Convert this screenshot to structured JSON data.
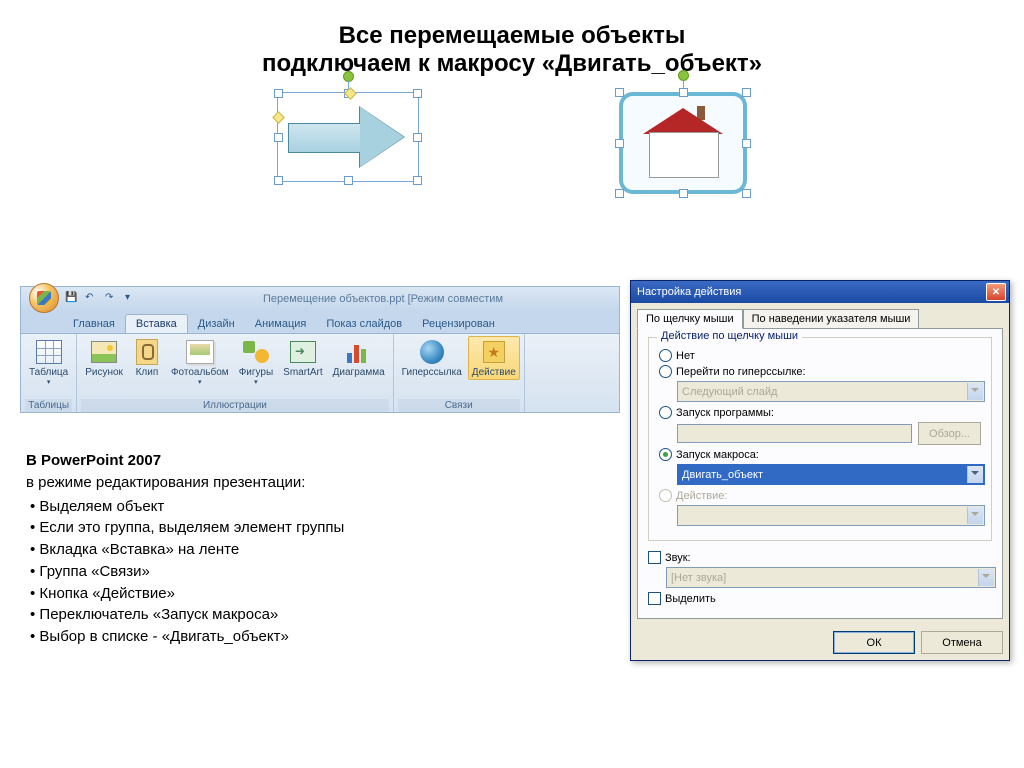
{
  "title_line1": "Все перемещаемые объекты",
  "title_line2": "подключаем к макросу «Двигать_объект»",
  "ribbon": {
    "window_title": "Перемещение объектов.ppt [Режим совместим",
    "tabs": {
      "home": "Главная",
      "insert": "Вставка",
      "design": "Дизайн",
      "anim": "Анимация",
      "show": "Показ слайдов",
      "review": "Рецензирован"
    },
    "buttons": {
      "table": "Таблица",
      "picture": "Рисунок",
      "clip": "Клип",
      "album": "Фотоальбом",
      "shapes": "Фигуры",
      "smartart": "SmartArt",
      "chart": "Диаграмма",
      "hyperlink": "Гиперссылка",
      "action": "Действие"
    },
    "groups": {
      "tables": "Таблицы",
      "illustrations": "Иллюстрации",
      "links": "Связи"
    }
  },
  "instructions": {
    "hdr": "В PowerPoint 2007",
    "intro": "в режиме редактирования презентации:",
    "items": [
      "Выделяем объект",
      "Если это группа, выделяем элемент группы",
      "Вкладка «Вставка» на ленте",
      "Группа «Связи»",
      "Кнопка «Действие»",
      "Переключатель «Запуск макроса»",
      "Выбор в списке - «Двигать_объект»"
    ]
  },
  "dialog": {
    "title": "Настройка действия",
    "tab_click": "По щелчку мыши",
    "tab_hover": "По наведении указателя мыши",
    "legend": "Действие по щелчку мыши",
    "r_none": "Нет",
    "r_hyper": "Перейти по гиперссылке:",
    "r_run": "Запуск программы:",
    "r_macro": "Запуск макроса:",
    "r_action": "Действие:",
    "hyper_combo": "Следующий слайд",
    "macro_combo": "Двигать_объект",
    "browse": "Обзор...",
    "sound_label": "Звук:",
    "sound_combo": "[Нет звука]",
    "highlight": "Выделить",
    "ok": "ОК",
    "cancel": "Отмена"
  }
}
